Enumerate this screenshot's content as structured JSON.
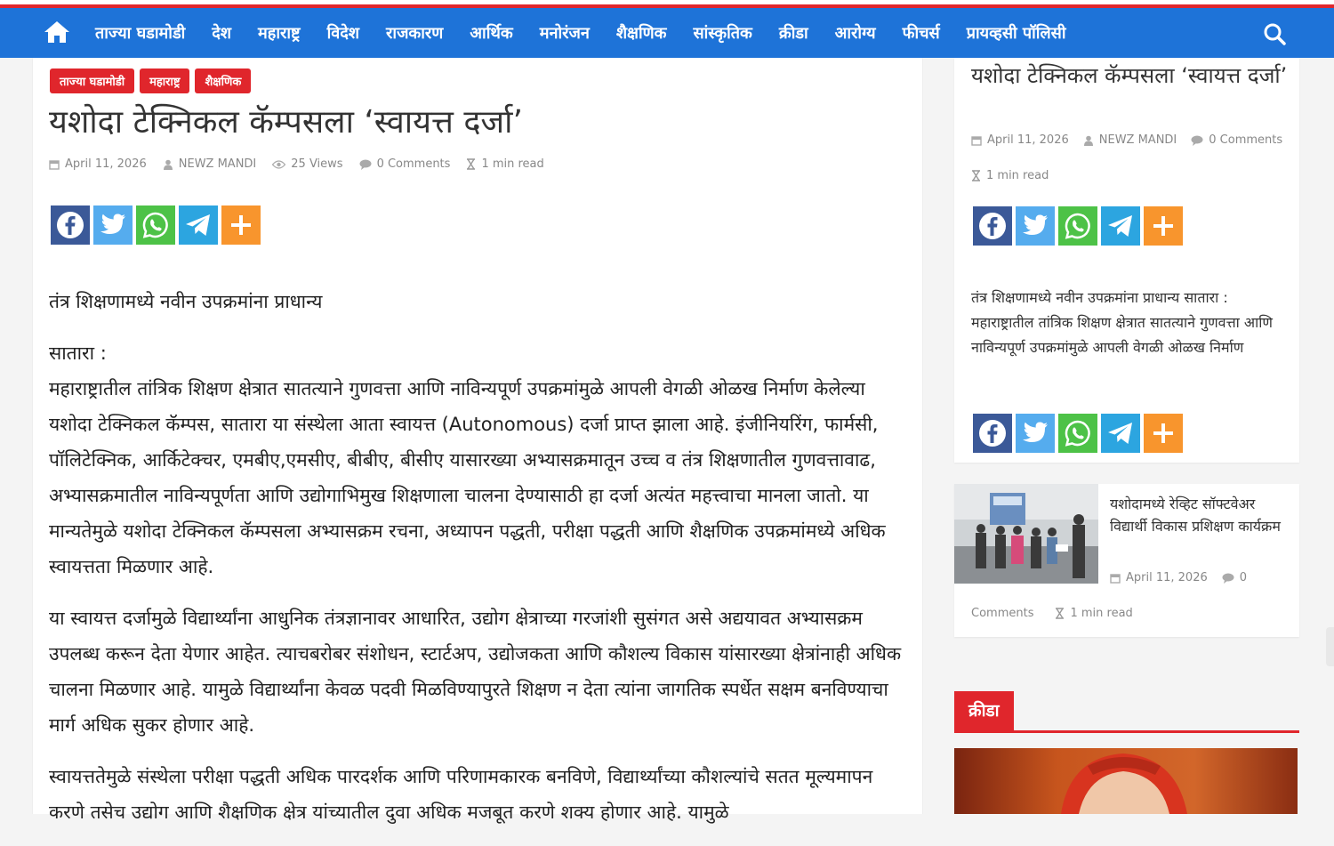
{
  "nav": {
    "items": [
      "ताज्या घडामोडी",
      "देश",
      "महाराष्ट्र",
      "विदेश",
      "राजकारण",
      "आर्थिक",
      "मनोरंजन",
      "शैक्षणिक",
      "सांस्कृतिक",
      "क्रीडा",
      "आरोग्य",
      "फीचर्स",
      "प्रायव्हसी पॉलिसी"
    ]
  },
  "article": {
    "categories": [
      "ताज्या घडामोडी",
      "महाराष्ट्र",
      "शैक्षणिक"
    ],
    "title": "यशोदा टेक्निकल कॅम्पसला ‘स्वायत्त दर्जा’",
    "meta": {
      "date": "April 11, 2026",
      "author": "NEWZ MANDI",
      "views": "25 Views",
      "comments": "0 Comments",
      "read_time": "1 min read"
    },
    "lead": "तंत्र शिक्षणामध्ये नवीन उपक्रमांना प्राधान्य",
    "dateline": "सातारा :",
    "para1": "महाराष्ट्रातील तांत्रिक शिक्षण क्षेत्रात सातत्याने गुणवत्ता आणि नाविन्यपूर्ण उपक्रमांमुळे आपली वेगळी ओळख निर्माण केलेल्या यशोदा टेक्निकल कॅम्पस, सातारा या संस्थेला आता स्वायत्त (Autonomous) दर्जा प्राप्त झाला आहे. इंजीनियरिंग, फार्मसी, पॉलिटेक्निक, आर्किटेक्चर, एमबीए,एमसीए, बीबीए, बीसीए यासारख्या अभ्यासक्रमातून उच्च व तंत्र शिक्षणातील गुणवत्तावाढ, अभ्यासक्रमातील नाविन्यपूर्णता आणि उद्योगाभिमुख शिक्षणाला चालना देण्यासाठी हा दर्जा अत्यंत महत्त्वाचा मानला जातो. या मान्यतेमुळे यशोदा टेक्निकल कॅम्पसला अभ्यासक्रम रचना, अध्यापन पद्धती, परीक्षा पद्धती आणि शैक्षणिक उपक्रमांमध्ये अधिक स्वायत्तता मिळणार आहे.",
    "para2": "या स्वायत्त दर्जामुळे विद्यार्थ्यांना आधुनिक तंत्रज्ञानावर आधारित, उद्योग क्षेत्राच्या गरजांशी सुसंगत असे अद्ययावत अभ्यासक्रम उपलब्ध करून देता येणार आहेत. त्याचबरोबर संशोधन, स्टार्टअप, उद्योजकता आणि कौशल्य विकास यांसारख्या क्षेत्रांनाही अधिक चालना मिळणार आहे. यामुळे विद्यार्थ्यांना केवळ पदवी मिळविण्यापुरते शिक्षण न देता त्यांना जागतिक स्पर्धेत सक्षम बनविण्याचा मार्ग अधिक सुकर होणार आहे.",
    "para3": "स्वायत्ततेमुळे संस्थेला परीक्षा पद्धती अधिक पारदर्शक आणि परिणामकारक बनविणे, विद्यार्थ्यांच्या कौशल्यांचे सतत मूल्यमापन करणे तसेच उद्योग आणि शैक्षणिक क्षेत्र यांच्यातील दुवा अधिक मजबूत करणे शक्य होणार आहे. यामुळे"
  },
  "sidebar": {
    "title": "यशोदा टेक्निकल कॅम्पसला ‘स्वायत्त दर्जा’",
    "meta": {
      "date": "April 11, 2026",
      "author": "NEWZ MANDI",
      "comments": "0 Comments",
      "read_time": "1 min read"
    },
    "excerpt": "तंत्र शिक्षणामध्ये नवीन उपक्रमांना प्राधान्य सातारा : महाराष्ट्रातील तांत्रिक शिक्षण क्षेत्रात सातत्याने गुणवत्ता आणि नाविन्यपूर्ण उपक्रमांमुळे आपली वेगळी ओळख निर्माण",
    "related": {
      "title": "यशोदामध्ये रेव्हिट सॉफ्टवेअर विद्यार्थी विकास प्रशिक्षण कार्यक्रम",
      "date": "April 11, 2026",
      "comments_count": "0",
      "comments_word": "Comments",
      "read_time": "1 min read"
    },
    "section_title": "क्रीडा"
  },
  "share": {
    "icons": [
      "facebook-icon",
      "twitter-icon",
      "whatsapp-icon",
      "telegram-icon",
      "more-icon"
    ],
    "colors": {
      "facebook": "#3b5998",
      "twitter": "#55acee",
      "whatsapp": "#4dc247",
      "telegram": "#2ca5e0",
      "more": "#f8952d"
    }
  },
  "colors": {
    "nav": "#1e73d8",
    "accent": "#e0262c"
  }
}
